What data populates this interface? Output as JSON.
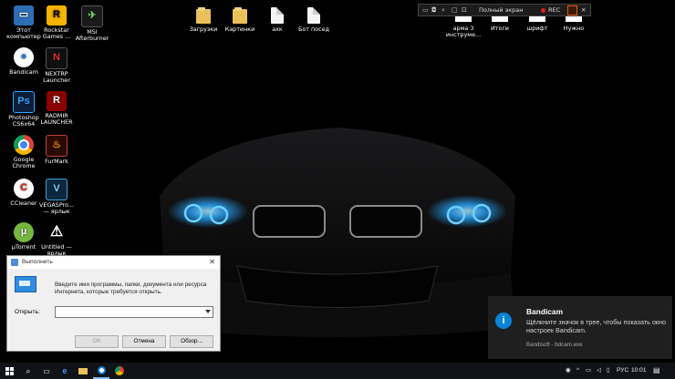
{
  "desktop": {
    "icons_left": [
      {
        "label": "Этот компьютер",
        "icon": "computer-icon"
      },
      {
        "label": "Rockstar Games ...",
        "icon": "rockstar-icon"
      },
      {
        "label": "MSI Afterburner",
        "icon": "msi-afterburner-icon"
      },
      {
        "label": "Bandicam",
        "icon": "bandicam-icon"
      },
      {
        "label": "NEXTRP Launcher",
        "icon": "nextrp-icon"
      },
      {
        "label": "Photoshop CS6x64",
        "icon": "photoshop-icon"
      },
      {
        "label": "RADMIR LAUNCHER",
        "icon": "radmir-icon"
      },
      {
        "label": "Google Chrome",
        "icon": "chrome-icon"
      },
      {
        "label": "FurMark",
        "icon": "furmark-icon"
      },
      {
        "label": "CCleaner",
        "icon": "ccleaner-icon"
      },
      {
        "label": "VEGASPro... — ярлык",
        "icon": "vegas-icon"
      },
      {
        "label": "µTorrent",
        "icon": "utorrent-icon"
      },
      {
        "label": "Untitled — ярлык",
        "icon": "shortcut-warning-icon"
      }
    ],
    "icons_top": [
      {
        "label": "Загрузки",
        "icon": "folder-icon"
      },
      {
        "label": "Картинки",
        "icon": "folder-icon"
      },
      {
        "label": "ахк",
        "icon": "document-icon"
      },
      {
        "label": "Бот посед",
        "icon": "document-icon"
      }
    ],
    "icons_right": [
      {
        "label": "арма 3 инструме...",
        "icon": "blank-icon"
      },
      {
        "label": "Итоги",
        "icon": "blank-icon"
      },
      {
        "label": "шрифт",
        "icon": "blank-icon"
      },
      {
        "label": "Нужно",
        "icon": "blank-icon"
      }
    ]
  },
  "recorder_bar": {
    "title": "Полный экран",
    "rec_label": "REC"
  },
  "run_dialog": {
    "title": "Выполнить",
    "description": "Введите имя программы, папки, документа или ресурса Интернета, которые требуется открыть.",
    "open_label": "Открыть:",
    "open_value": "",
    "ok_label": "ОК",
    "cancel_label": "Отмена",
    "browse_label": "Обзор..."
  },
  "notification": {
    "title": "Bandicam",
    "message": "Щёлкните значок в трее, чтобы показать окно настроек Bandicam.",
    "source": "Bandisoft - bdcam.exe"
  },
  "taskbar": {
    "language": "РУС",
    "time": "10:01"
  },
  "colors": {
    "accent": "#0a84d8",
    "headlight": "#29a8ff",
    "rec_red": "#e02020"
  }
}
